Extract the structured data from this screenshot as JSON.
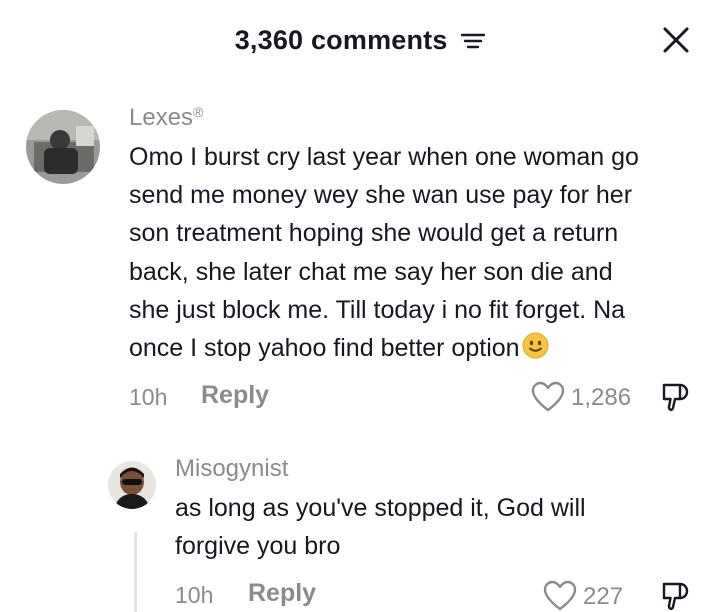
{
  "header": {
    "title": "3,360 comments",
    "sort_icon": "filter-lines-icon",
    "close_icon": "close-icon"
  },
  "comments": [
    {
      "username": "Lexes",
      "username_mark": "®",
      "text": "Omo I burst cry last year when one woman go send me money wey she wan use pay for her son treatment hoping she would get a return back, she later chat me say her son die and she just block me. Till today i no fit forget. Na once I stop yahoo find better option",
      "lines": [
        "Omo I burst cry last year when one woman go",
        "send me money wey she wan use pay for her",
        "son treatment hoping she would get a return",
        "back, she later chat me say her son die and",
        "she just block me. Till today i no fit forget. Na",
        "once I stop yahoo find better option"
      ],
      "emoji": "slightly-smiling-face-icon",
      "time": "10h",
      "reply_label": "Reply",
      "likes": "1,286"
    },
    {
      "username": "Misogynist",
      "lines": [
        "as long as you've stopped it, God will",
        "forgive you bro"
      ],
      "time": "10h",
      "reply_label": "Reply",
      "likes": "227"
    }
  ],
  "colors": {
    "text": "#161823",
    "muted": "#8a8b91",
    "emoji": "#f7c53d"
  }
}
